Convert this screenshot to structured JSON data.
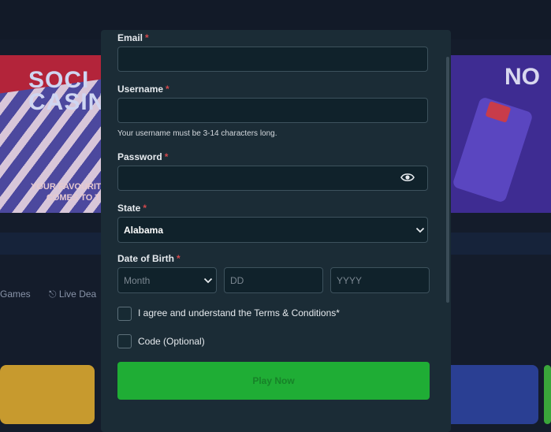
{
  "background": {
    "banner_left_title": "SOCI\nCASIN",
    "banner_left_subtitle": "YOUR FAVOURITE C\nCOMES TO T",
    "banner_right_title": "NO",
    "nav": {
      "games_label": "Games",
      "live_label": "Live Dea"
    }
  },
  "form": {
    "email": {
      "label": "Email",
      "required": "*",
      "value": ""
    },
    "username": {
      "label": "Username",
      "required": "*",
      "value": "",
      "hint": "Your username must be 3-14 characters long."
    },
    "password": {
      "label": "Password",
      "required": "*",
      "value": ""
    },
    "state": {
      "label": "State",
      "required": "*",
      "value": "Alabama"
    },
    "dob": {
      "label": "Date of Birth",
      "required": "*",
      "month_placeholder": "Month",
      "day_placeholder": "DD",
      "year_placeholder": "YYYY"
    },
    "terms_label": "I agree and understand the Terms & Conditions*",
    "code_label": "Code (Optional)",
    "submit_label": "Play Now"
  },
  "colors": {
    "modal_bg": "#1b2c36",
    "input_bg": "#10222b",
    "required": "#d2494c",
    "button": "#1fad35"
  },
  "icons": [
    "eye-icon",
    "chevron-down-icon",
    "headset-icon"
  ]
}
